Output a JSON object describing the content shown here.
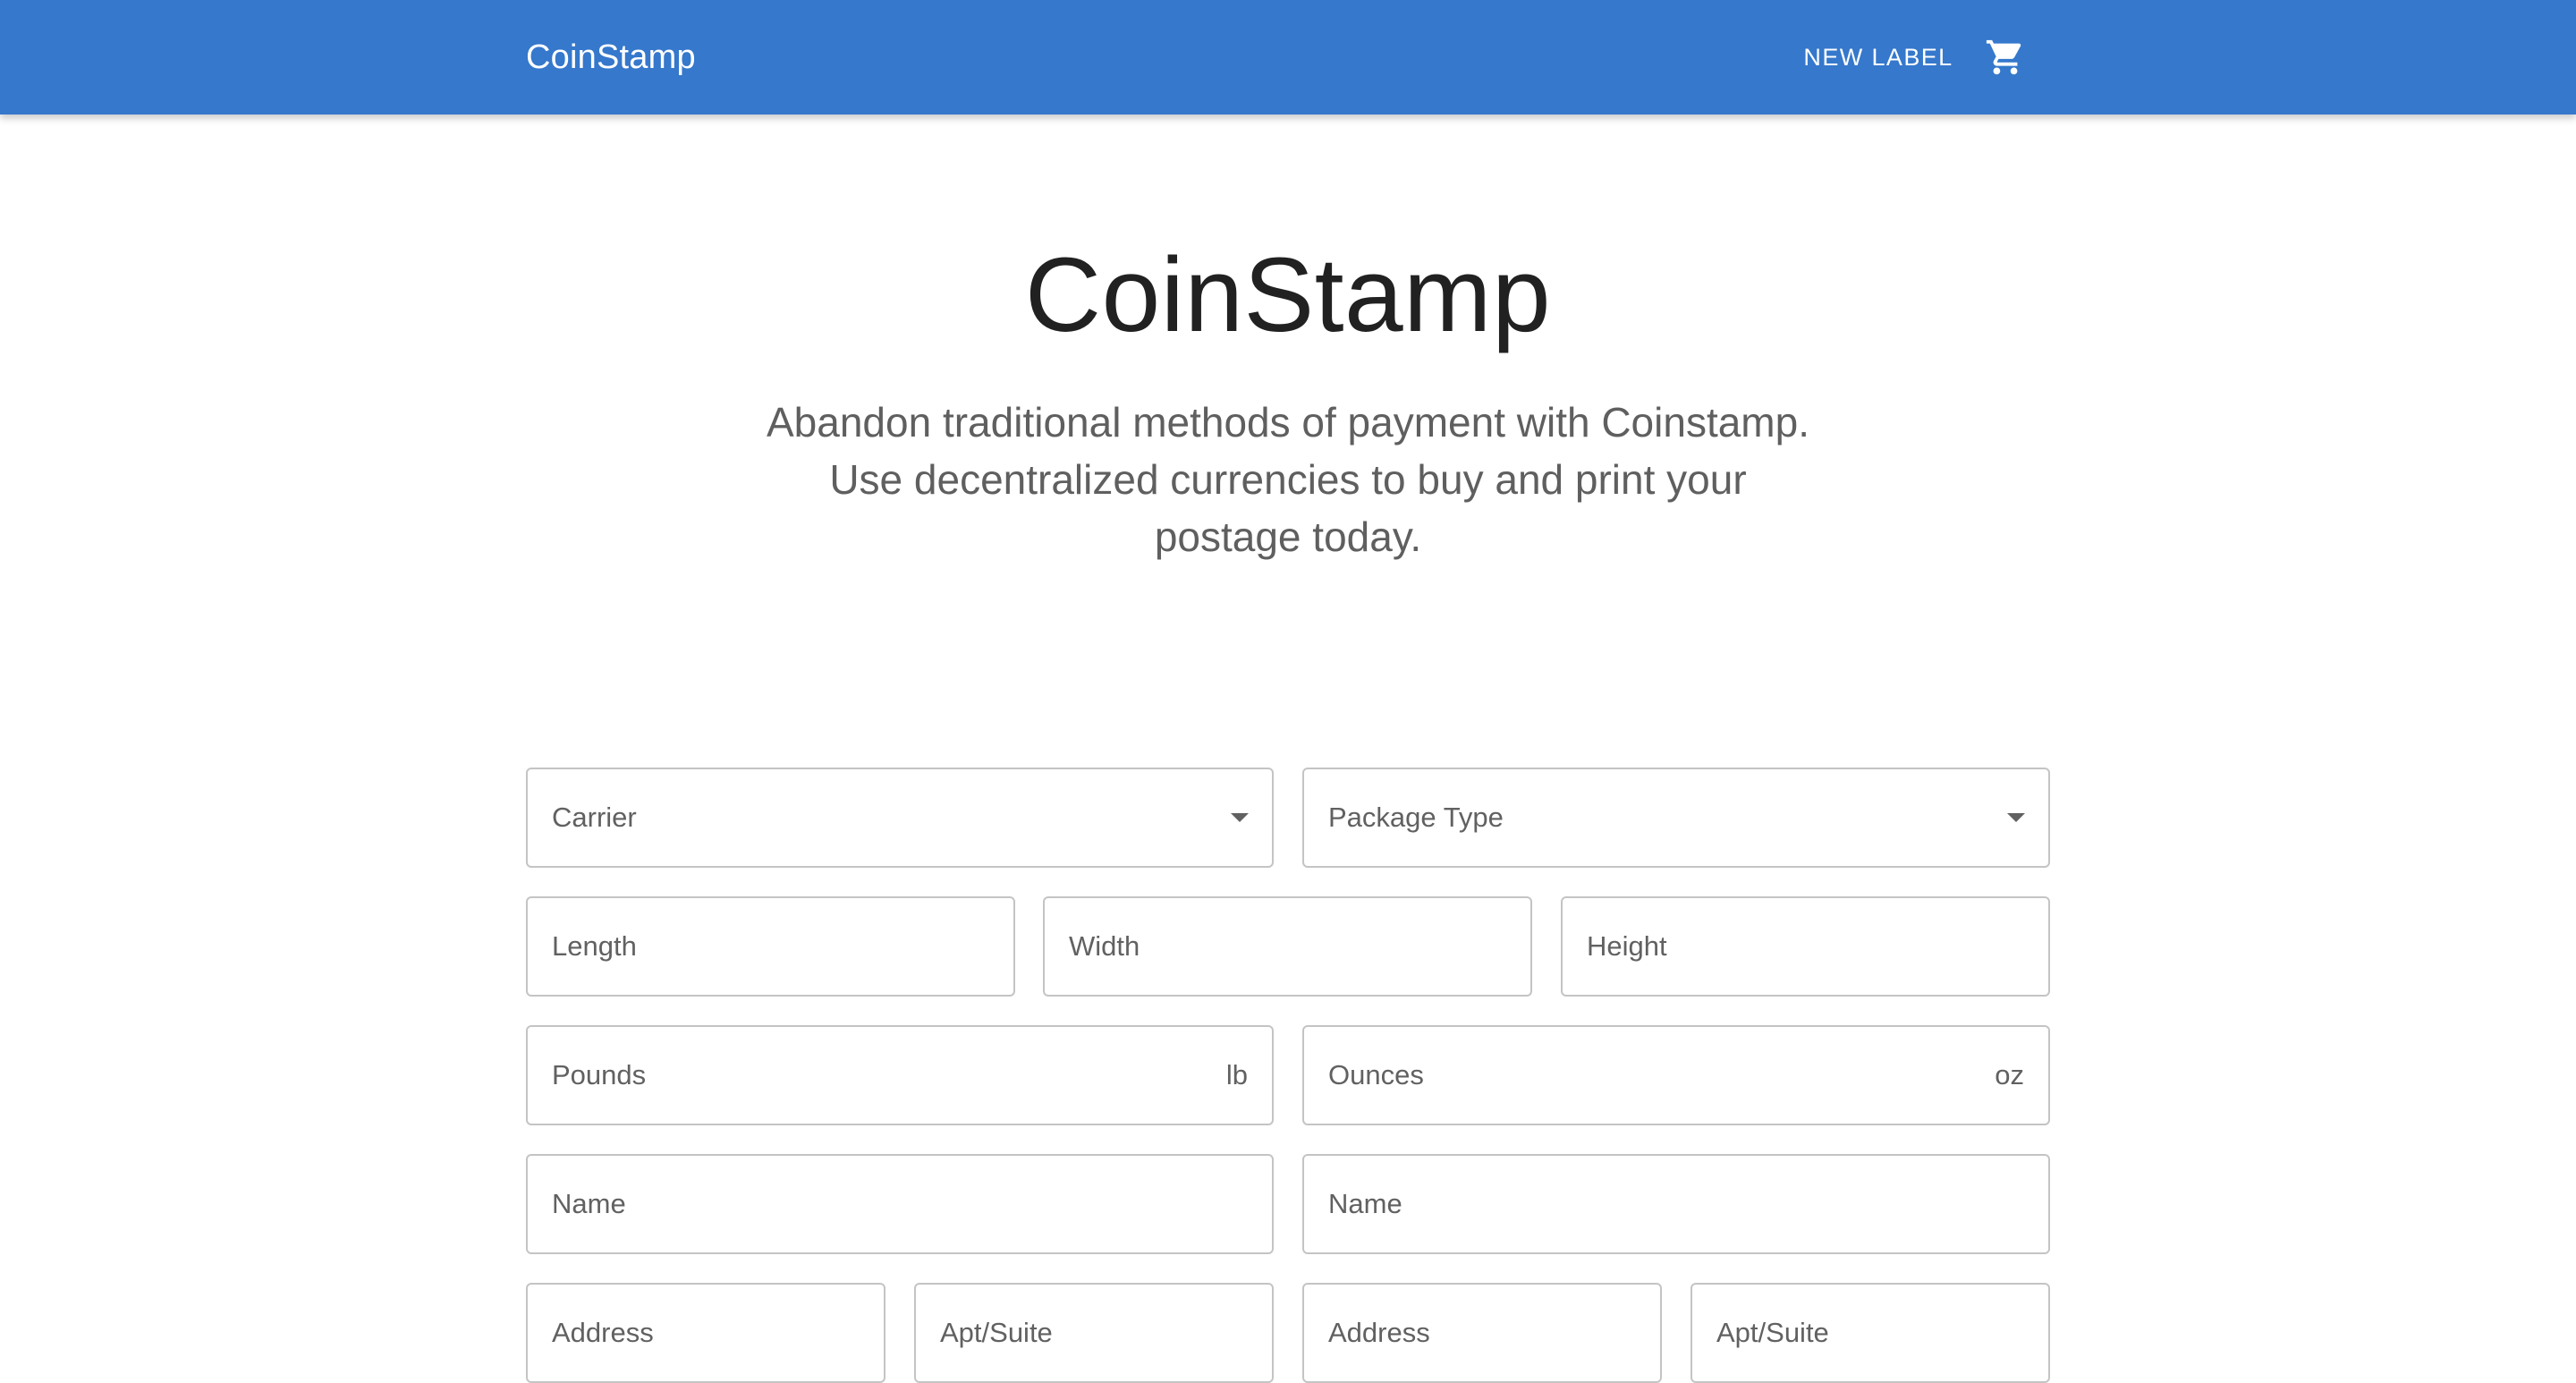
{
  "header": {
    "brand": "CoinStamp",
    "new_label_button": "NEW LABEL",
    "cart_icon": "shopping-cart-icon",
    "accent_color": "#3578cc"
  },
  "hero": {
    "title": "CoinStamp",
    "subtitle": "Abandon traditional methods of payment with Coinstamp. Use decentralized currencies to buy and print your postage today."
  },
  "form": {
    "carrier_label": "Carrier",
    "package_type_label": "Package Type",
    "length_label": "Length",
    "width_label": "Width",
    "height_label": "Height",
    "pounds_label": "Pounds",
    "pounds_unit": "lb",
    "ounces_label": "Ounces",
    "ounces_unit": "oz",
    "from_name_label": "Name",
    "to_name_label": "Name",
    "from_address_label": "Address",
    "from_apt_label": "Apt/Suite",
    "to_address_label": "Address",
    "to_apt_label": "Apt/Suite"
  }
}
